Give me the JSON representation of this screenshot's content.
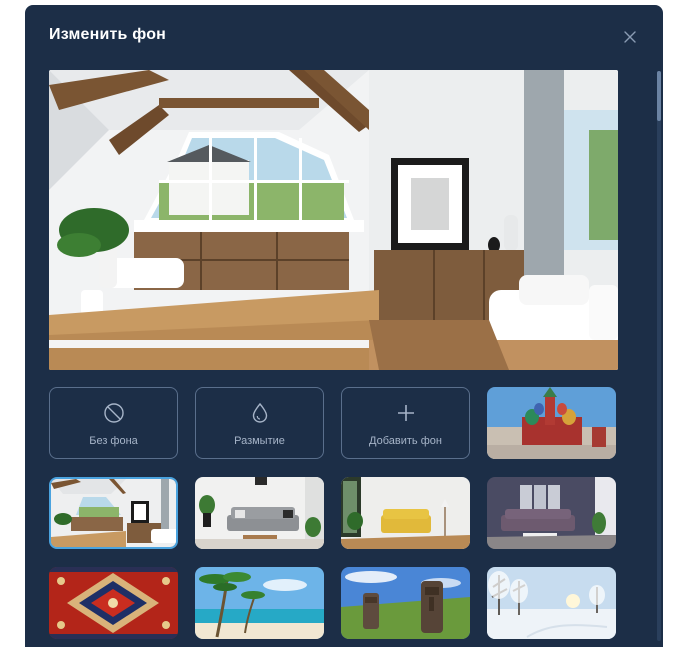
{
  "dialog": {
    "title": "Изменить фон",
    "close_icon": "close-icon"
  },
  "options": {
    "no_background": {
      "label": "Без фона",
      "icon": "no-background-icon"
    },
    "blur": {
      "label": "Размытие",
      "icon": "blur-drop-icon"
    },
    "add_background": {
      "label": "Добавить фон",
      "icon": "plus-icon"
    }
  },
  "backgrounds": [
    {
      "name": "moscow-cathedral",
      "selected": false
    },
    {
      "name": "attic-living-room",
      "selected": true
    },
    {
      "name": "grey-sofa-room",
      "selected": false
    },
    {
      "name": "yellow-sofa-room",
      "selected": false
    },
    {
      "name": "purple-lounge",
      "selected": false
    },
    {
      "name": "red-carpet",
      "selected": false
    },
    {
      "name": "tropical-beach",
      "selected": false
    },
    {
      "name": "easter-island-moai",
      "selected": false
    },
    {
      "name": "snowy-forest",
      "selected": false
    }
  ],
  "colors": {
    "dialog_bg": "#1c2e47",
    "border": "#5a6f8c",
    "selected_border": "#4aa3df",
    "label_text": "#a6b4c8"
  }
}
